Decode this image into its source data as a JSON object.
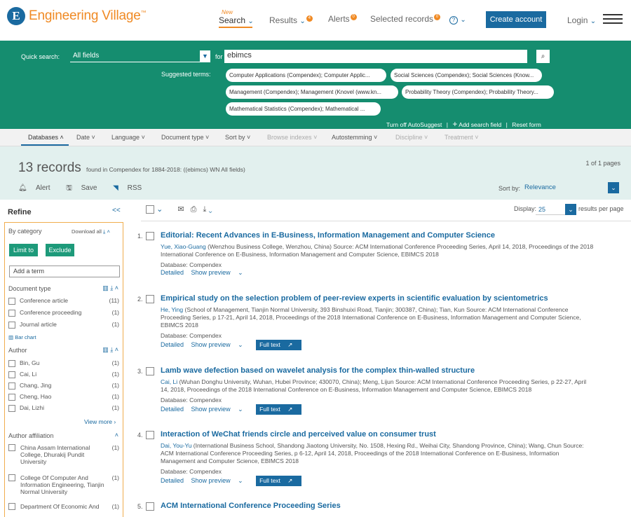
{
  "header": {
    "brand": "Engineering Village",
    "brand_mark": "E",
    "nav": {
      "search_new": "New",
      "search": "Search",
      "results": "Results",
      "results_badge": "4",
      "alerts": "Alerts",
      "alerts_badge": "0",
      "selected": "Selected records",
      "selected_badge": "0",
      "help": "?",
      "create_account": "Create account",
      "login": "Login"
    }
  },
  "search": {
    "quick_label": "Quick search:",
    "field_value": "All fields",
    "for_label": "for",
    "query": "ebimcs",
    "suggested_label": "Suggested terms:",
    "chips": [
      "Computer Applications (Compendex); Computer Applic...",
      "Social Sciences (Compendex); Social Sciences (Know...",
      "Management (Compendex); Management (Knovel (www.kn...",
      "Probability Theory (Compendex); Probability Theory...",
      "Mathematical Statistics (Compendex); Mathematical ..."
    ],
    "links": {
      "autosuggest": "Turn off AutoSuggest",
      "add_field": "Add search field",
      "reset": "Reset form"
    }
  },
  "filters": {
    "items": [
      "Databases",
      "Date",
      "Language",
      "Document type",
      "Sort by",
      "Browse indexes",
      "Autostemming",
      "Discipline",
      "Treatment"
    ]
  },
  "results": {
    "count": "13 records",
    "found_in": "found in Compendex for 1884-2018: ((ebimcs) WN All fields)",
    "pages": "1 of 1 pages",
    "tools": {
      "alert": "Alert",
      "save": "Save",
      "rss": "RSS"
    },
    "sort_label": "Sort by:",
    "sort_value": "Relevance",
    "display_label": "Display:",
    "display_value": "25",
    "per_page": "results per page"
  },
  "refine": {
    "title": "Refine",
    "collapse": "<<",
    "by_category": "By category",
    "download_all": "Download all",
    "limit_to": "Limit to",
    "exclude": "Exclude",
    "add_term_placeholder": "Add a term",
    "doc_type_title": "Document type",
    "doc_types": [
      {
        "label": "Conference article",
        "count": "(11)"
      },
      {
        "label": "Conference proceeding",
        "count": "(1)"
      },
      {
        "label": "Journal article",
        "count": "(1)"
      }
    ],
    "bar_chart": "Bar chart",
    "author_title": "Author",
    "authors": [
      {
        "label": "Bin, Gu",
        "count": "(1)"
      },
      {
        "label": "Cai, Li",
        "count": "(1)"
      },
      {
        "label": "Chang, Jing",
        "count": "(1)"
      },
      {
        "label": "Cheng, Hao",
        "count": "(1)"
      },
      {
        "label": "Dai, Lizhi",
        "count": "(1)"
      }
    ],
    "view_more": "View more",
    "affil_title": "Author affiliation",
    "affils": [
      {
        "label": "China Assam International College, Dhurakij Pundit University",
        "count": "(1)"
      },
      {
        "label": "College Of Computer And Information Engineering, Tianjin Normal University",
        "count": "(1)"
      },
      {
        "label": "Department Of Economic And",
        "count": "(1)"
      }
    ]
  },
  "records": [
    {
      "num": "1.",
      "title": "Editorial: Recent Advances in E-Business, Information Management and Computer Science",
      "author": "Yue, Xiao-Guang",
      "rest": " (Wenzhou Business College, Wenzhou, China) Source: ACM International Conference Proceeding Series, April 14, 2018, Proceedings of the 2018 International Conference on E-Business, Information Management and Computer Science, EBIMCS 2018",
      "database": "Database:   Compendex",
      "detailed": "Detailed",
      "preview": "Show preview"
    },
    {
      "num": "2.",
      "title": "Empirical study on the selection problem of peer-review experts in scientific evaluation by scientometrics",
      "author": "He, Ying",
      "rest": " (School of Management, Tianjin Normal University, 393 Binshuixi Road, Tianjin; 300387, China); Tian, Kun Source: ACM International Conference Proceeding Series, p 17-21, April 14, 2018, Proceedings of the 2018 International Conference on E-Business, Information Management and Computer Science, EBIMCS 2018",
      "database": "Database:   Compendex",
      "detailed": "Detailed",
      "preview": "Show preview",
      "fulltext": "Full text"
    },
    {
      "num": "3.",
      "title": "Lamb wave defection based on wavelet analysis for the complex thin-walled structure",
      "author": "Cai, Li",
      "rest": " (Wuhan Donghu University, Wuhan, Hubei Province; 430070, China); Meng, Lijun Source: ACM International Conference Proceeding Series, p 22-27, April 14, 2018, Proceedings of the 2018 International Conference on E-Business, Information Management and Computer Science, EBIMCS 2018",
      "database": "Database:   Compendex",
      "detailed": "Detailed",
      "preview": "Show preview",
      "fulltext": "Full text"
    },
    {
      "num": "4.",
      "title": "Interaction of WeChat friends circle and perceived value on consumer trust",
      "author": "Dai, You-Yu",
      "rest": " (International Business School, Shandong Jiaotong University, No. 1508, Hexing Rd., Weihai City, Shandong Province, China); Wang, Chun Source: ACM International Conference Proceeding Series, p 6-12, April 14, 2018, Proceedings of the 2018 International Conference on E-Business, Information Management and Computer Science, EBIMCS 2018",
      "database": "Database:   Compendex",
      "detailed": "Detailed",
      "preview": "Show preview",
      "fulltext": "Full text"
    },
    {
      "num": "5.",
      "title": "ACM International Conference Proceeding Series"
    }
  ]
}
